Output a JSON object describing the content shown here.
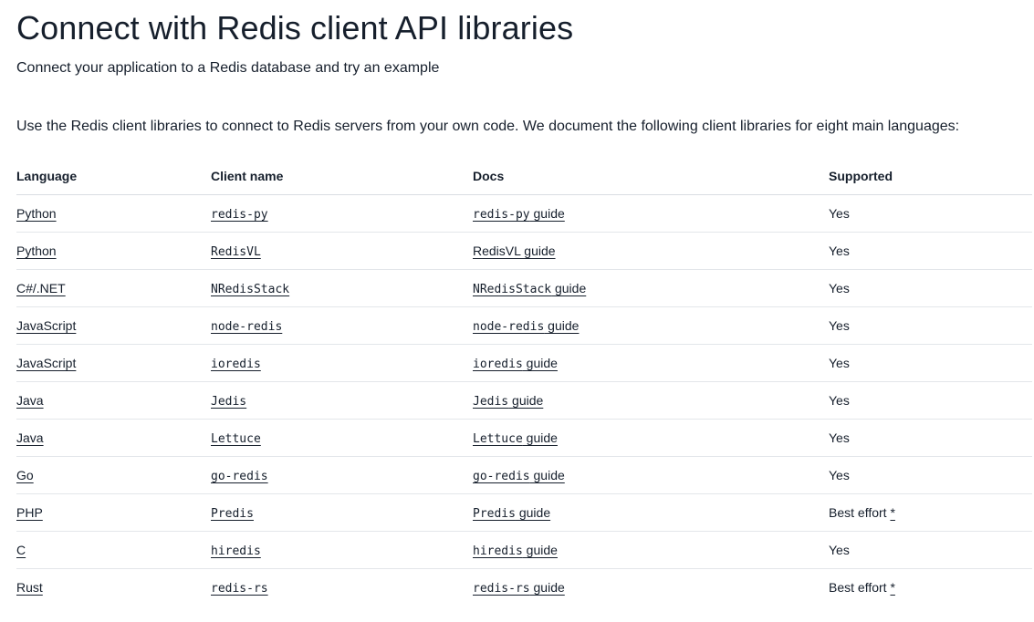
{
  "page": {
    "title": "Connect with Redis client API libraries",
    "subtitle": "Connect your application to a Redis database and try an example",
    "intro": "Use the Redis client libraries to connect to Redis servers from your own code. We document the following client libraries for eight main languages:"
  },
  "table": {
    "headers": [
      "Language",
      "Client name",
      "Docs",
      "Supported"
    ],
    "rows": [
      {
        "language": "Python",
        "client": "redis-py",
        "docs_code": "redis-py",
        "docs_suffix": " guide",
        "supported": "Yes",
        "star": ""
      },
      {
        "language": "Python",
        "client": "RedisVL",
        "docs_code": "",
        "docs_suffix": "RedisVL guide",
        "supported": "Yes",
        "star": ""
      },
      {
        "language": "C#/.NET",
        "client": "NRedisStack",
        "docs_code": "NRedisStack",
        "docs_suffix": " guide",
        "supported": "Yes",
        "star": ""
      },
      {
        "language": "JavaScript",
        "client": "node-redis",
        "docs_code": "node-redis",
        "docs_suffix": " guide",
        "supported": "Yes",
        "star": ""
      },
      {
        "language": "JavaScript",
        "client": "ioredis",
        "docs_code": "ioredis",
        "docs_suffix": " guide",
        "supported": "Yes",
        "star": ""
      },
      {
        "language": "Java",
        "client": "Jedis",
        "docs_code": "Jedis",
        "docs_suffix": " guide",
        "supported": "Yes",
        "star": ""
      },
      {
        "language": "Java",
        "client": "Lettuce",
        "docs_code": "Lettuce",
        "docs_suffix": " guide",
        "supported": "Yes",
        "star": ""
      },
      {
        "language": "Go",
        "client": "go-redis",
        "docs_code": "go-redis",
        "docs_suffix": " guide",
        "supported": "Yes",
        "star": ""
      },
      {
        "language": "PHP",
        "client": "Predis",
        "docs_code": "Predis",
        "docs_suffix": " guide",
        "supported": "Best effort ",
        "star": "*"
      },
      {
        "language": "C",
        "client": "hiredis",
        "docs_code": "hiredis",
        "docs_suffix": " guide",
        "supported": "Yes",
        "star": ""
      },
      {
        "language": "Rust",
        "client": "redis-rs",
        "docs_code": "redis-rs",
        "docs_suffix": " guide",
        "supported": "Best effort ",
        "star": "*"
      }
    ]
  }
}
